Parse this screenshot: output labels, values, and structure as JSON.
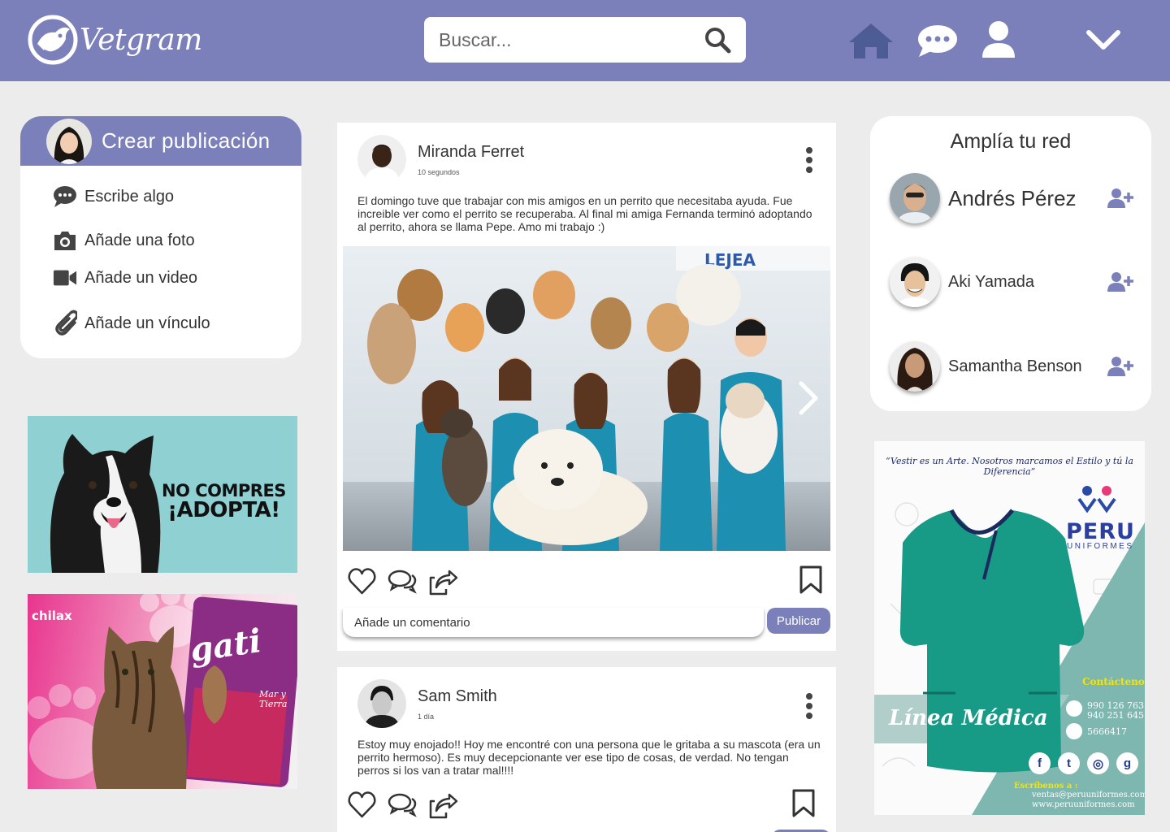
{
  "header": {
    "brand": "Vetgram",
    "search_placeholder": "Buscar...",
    "nav": [
      "home-icon",
      "chat-icon",
      "user-icon",
      "chevron-down-icon"
    ],
    "accent": "#7b80ba"
  },
  "create": {
    "title": "Crear publicación",
    "items": [
      {
        "label": "Escribe algo",
        "icon": "chat-bubble-icon"
      },
      {
        "label": "Añade una foto",
        "icon": "camera-icon"
      },
      {
        "label": "Añade un video",
        "icon": "video-icon"
      },
      {
        "label": "Añade un vínculo",
        "icon": "paperclip-icon"
      }
    ]
  },
  "ads": {
    "adopt_line1": "NO COMPRES",
    "adopt_line2": "¡ADOPTA!",
    "cat_brand": "chilax",
    "cat_product": "gati",
    "cat_flavor": "Mar y Tierra"
  },
  "posts": [
    {
      "author": "Miranda Ferret",
      "time": "10 segundos",
      "text": "El domingo tuve que trabajar con mis amigos en un perrito que necesitaba ayuda. Fue increible ver como el perrito se recuperaba. Al final mi amiga Fernanda terminó adoptando al perrito, ahora se llama Pepe. Amo mi trabajo :)",
      "photo_sign": "LEJEA",
      "comment_placeholder": "Añade un comentario",
      "publish_label": "Publicar"
    },
    {
      "author": "Sam Smith",
      "time": "1 día",
      "text": "Estoy muy enojado!! Hoy me encontré con una persona que le gritaba a su mascota (era un perrito hermoso). Es muy decepcionante ver ese tipo de cosas, de verdad. No tengan perros si los van a tratar mal!!!!"
    }
  ],
  "network": {
    "title": "Amplía tu red",
    "people": [
      {
        "name": "Andrés Pérez"
      },
      {
        "name": "Aki Yamada"
      },
      {
        "name": "Samantha Benson"
      }
    ]
  },
  "uniform_ad": {
    "quote": "“Vestir es un Arte. Nosotros marcamos el Estilo y tú la Diferencia”",
    "brand": "PERU",
    "brand_sub": "UNIFORMES",
    "line": "Línea Médica",
    "contact_label": "Contáctenos:",
    "phone1": "990 126 763",
    "phone2": "940 251 645",
    "phone3": "5666417",
    "write_label": "Escríbenos a :",
    "email": "ventas@peruuniformes.com",
    "web": "www.peruuniformes.com"
  }
}
